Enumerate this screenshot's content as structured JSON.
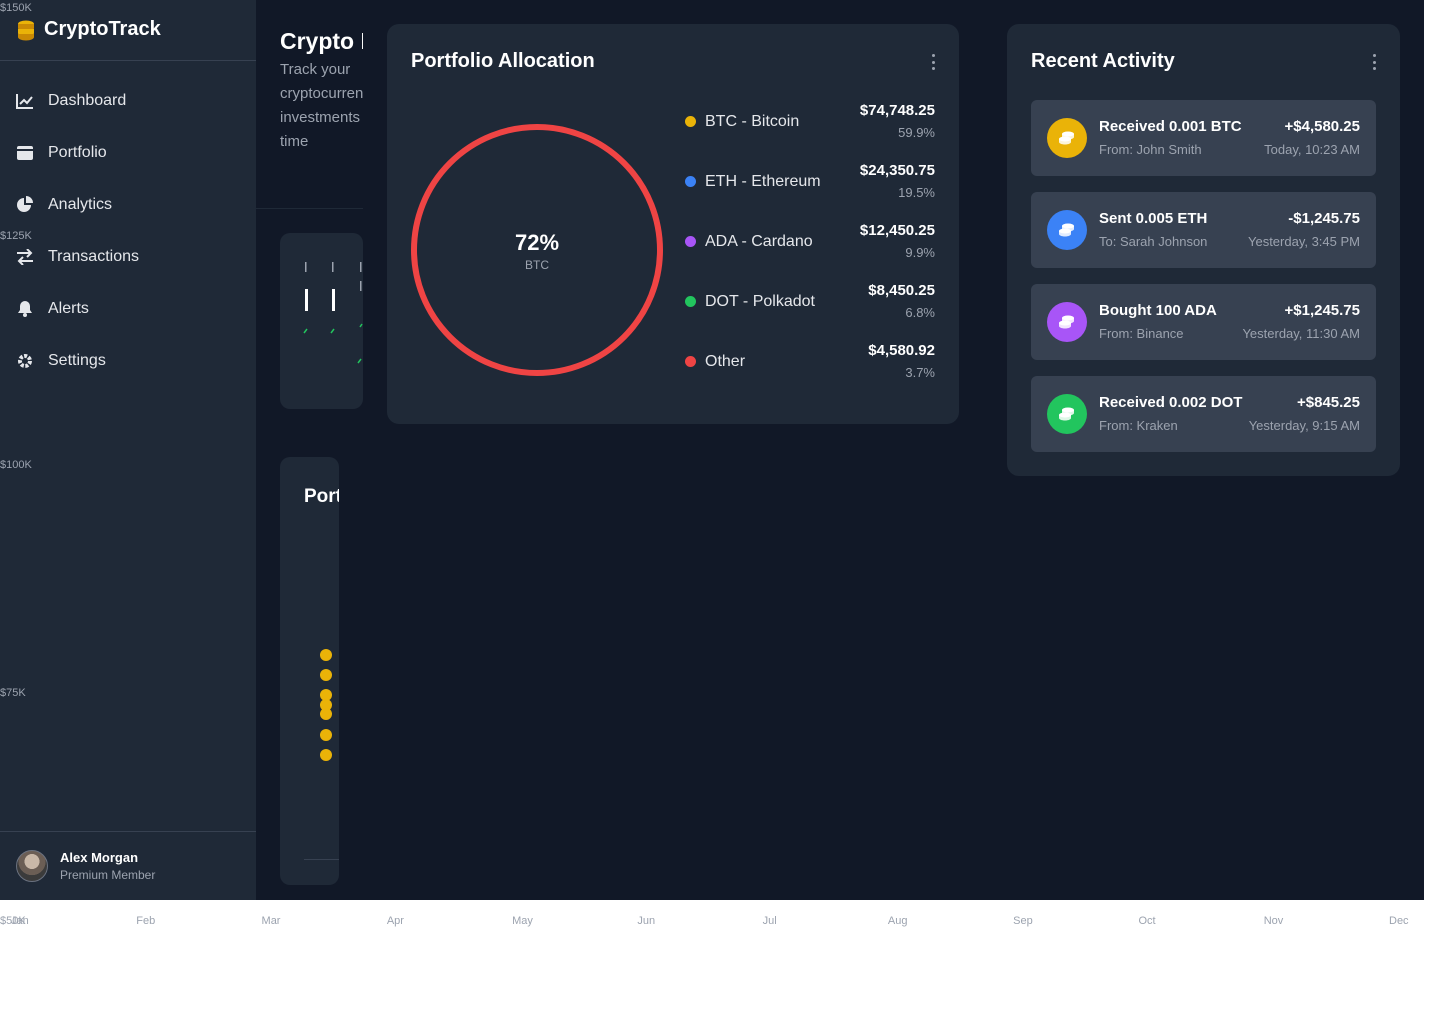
{
  "app": {
    "name": "CryptoTrack"
  },
  "sidebar": {
    "items": [
      {
        "label": "Dashboard",
        "icon": "chart-line-icon"
      },
      {
        "label": "Portfolio",
        "icon": "wallet-icon"
      },
      {
        "label": "Analytics",
        "icon": "pie-chart-icon"
      },
      {
        "label": "Transactions",
        "icon": "exchange-icon"
      },
      {
        "label": "Alerts",
        "icon": "bell-icon"
      },
      {
        "label": "Settings",
        "icon": "gear-icon"
      }
    ],
    "user": {
      "name": "Alex Morgan",
      "role": "Premium Member"
    }
  },
  "header": {
    "title": "Crypto Portfolio",
    "subtitle": "Track your cryptocurrency investments in real-time"
  },
  "performance": {
    "title": "Portfolio Performance"
  },
  "allocation": {
    "title": "Portfolio Allocation",
    "center_value": "72%",
    "center_label": "BTC",
    "items": [
      {
        "name": "BTC - Bitcoin",
        "value": "$74,748.25",
        "pct": "59.9%",
        "color": "#eab308"
      },
      {
        "name": "ETH - Ethereum",
        "value": "$24,350.75",
        "pct": "19.5%",
        "color": "#3b82f6"
      },
      {
        "name": "ADA - Cardano",
        "value": "$12,450.25",
        "pct": "9.9%",
        "color": "#a855f7"
      },
      {
        "name": "DOT - Polkadot",
        "value": "$8,450.25",
        "pct": "6.8%",
        "color": "#22c55e"
      },
      {
        "name": "Other",
        "value": "$4,580.92",
        "pct": "3.7%",
        "color": "#ef4444"
      }
    ],
    "ring_color": "#ef4444"
  },
  "activity": {
    "title": "Recent Activity",
    "items": [
      {
        "title": "Received 0.001 BTC",
        "sub": "From: John Smith",
        "amount": "+$4,580.25",
        "time": "Today, 10:23 AM",
        "color": "#eab308"
      },
      {
        "title": "Sent 0.005 ETH",
        "sub": "To: Sarah Johnson",
        "amount": "-$1,245.75",
        "time": "Yesterday, 3:45 PM",
        "color": "#3b82f6"
      },
      {
        "title": "Bought 100 ADA",
        "sub": "From: Binance",
        "amount": "+$1,245.75",
        "time": "Yesterday, 11:30 AM",
        "color": "#a855f7"
      },
      {
        "title": "Received 0.002 DOT",
        "sub": "From: Kraken",
        "amount": "+$845.25",
        "time": "Yesterday, 9:15 AM",
        "color": "#22c55e"
      }
    ]
  },
  "chart_data": {
    "type": "line",
    "categories": [
      "Jan",
      "Feb",
      "Mar",
      "Apr",
      "May",
      "Jun",
      "Jul",
      "Aug",
      "Sep",
      "Oct",
      "Nov",
      "Dec"
    ],
    "y_tick_labels": [
      "$150K",
      "$125K",
      "$100K",
      "$75K",
      "$50K"
    ],
    "ylim": [
      50000,
      150000
    ],
    "series": []
  }
}
